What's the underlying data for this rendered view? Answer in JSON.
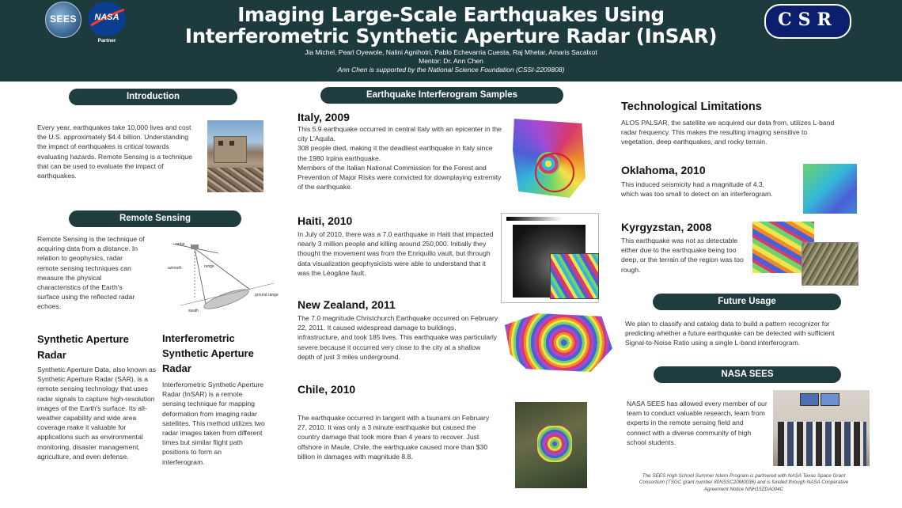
{
  "header": {
    "title_line1": "Imaging Large-Scale Earthquakes Using",
    "title_line2": "Interferometric Synthetic Aperture Radar (InSAR)",
    "authors": "Jia Michel, Pearl Oyewole, Nalini Agnihotri, Pablo Echevarria Cuesta, Raj Mhetar, Amaris Sacalxot",
    "mentor": "Mentor: Dr. Ann Chen",
    "support": "Ann Chen is supported by the National Science Foundation (CSSI-2209808)",
    "logo_sees": "SEES",
    "logo_nasa": "NASA",
    "logo_partner": "Partner",
    "logo_csr": "CSR"
  },
  "introduction": {
    "heading": "Introduction",
    "text": "Every year, earthquakes take 10,000 lives and cost the U.S. approximately $4.4 billion. Understanding the impact of earthquakes is critical towards evaluating hazards. Remote Sensing is a technique that can be used to evaluate the impact of earthquakes."
  },
  "remote_sensing": {
    "heading": "Remote Sensing",
    "text": "Remote Sensing is the technique of acquiring data from a distance. In relation to geophysics, radar remote sensing techniques can measure the physical characteristics of the Earth's surface using the reflected radar echoes.",
    "diagram_labels": {
      "radar": "radar",
      "azimuth": "azimuth",
      "range": "range",
      "ground_range": "ground range",
      "swath": "swath"
    }
  },
  "sar": {
    "heading": "Synthetic Aperture Radar",
    "text": "Synthetic Aperture Data, also known as Synthetic Aperture Radar (SAR), is a remote sensing technology that uses radar signals to capture high-resolution images of the Earth's surface. Its all-weather capability and wide area coverage make it valuable for applications such as environmental monitoring, disaster management, agriculture, and even defense."
  },
  "insar": {
    "heading": "Interferometric Synthetic Aperture Radar",
    "text": "Interferometric Synthetic Aperture Radar (InSAR) is a remote sensing technique for mapping deformation from imaging radar satellites. This method utilizes two radar images taken from different times but similar flight path positions to form an interferogram."
  },
  "samples": {
    "heading": "Earthquake Interferogram Samples",
    "italy": {
      "heading": "Italy, 2009",
      "text": "This 5.9 earthquake occurred in central Italy with an epicenter in the city L'Aquila.\n308 people died, making it the deadliest earthquake in Italy since the 1980 Irpina earthquake.\nMembers of the Italian National Commission for the Forest and Prevention of Major Risks were convicted for downplaying extremity of the earthquake."
    },
    "haiti": {
      "heading": "Haiti, 2010",
      "text": "In July of 2010, there was a 7.0 earthquake in Haiti that impacted nearly 3 million people and killing around 250,000. Initially they thought the movement was from the Enriquillo vault, but through data visualization geophysicists were able to understand that it was the Léogâne fault."
    },
    "nz": {
      "heading": "New Zealand, 2011",
      "text": "The 7.0 magnitude Christchurch Earthquake occurred on February 22, 2011. It caused widespread damage to buildings, infrastructure, and took 185 lives. This earthquake was particularly severe because it occurred very close to the city at a shallow depth of just 3 miles underground."
    },
    "chile": {
      "heading": "Chile, 2010",
      "text": "The earthquake occurred in tangent with a tsunami on February 27, 2010. It was only a 3 minute earthquake but caused the country damage that took more than 4 years to recover. Just offshore in Maule, Chile, the earthquake caused more than $30 billion in damages with magnitude 8.8."
    }
  },
  "limitations": {
    "heading": "Technological Limitations",
    "text": "ALOS PALSAR, the satellite we acquired our data from, utilizes L-band radar frequency. This makes the resulting imaging sensitive to vegetation, deep earthquakes, and rocky terrain.",
    "oklahoma": {
      "heading": "Oklahoma, 2010",
      "text": "This induced seismicity  had a magnitude of 4.3, which was too small to detect on an interferogram."
    },
    "kyrgyzstan": {
      "heading": "Kyrgyzstan, 2008",
      "text": "This earthquake was not as detectable either due to the earthquake being too deep, or the terrain of the region was too rough."
    }
  },
  "future": {
    "heading": "Future Usage",
    "text": "We plan to classify and catalog data to build a pattern recognizer for predicting whether a future earthquake can be detected with sufficient Signal-to-Noise Ratio using a single L-band interferogram."
  },
  "nasa_sees": {
    "heading": "NASA SEES",
    "text": "NASA SEES has allowed every member of our team to conduct valuable research, learn from experts in the remote sensing field and connect with a diverse community of high school students.",
    "footnote": "The SEES High School Summer Intern Program is partnered with NASA Texas Space Grant Consortium (TSGC grant number 80NSSC20M0036) and is funded through NASA Cooperative Agreement Notice NNH15ZDA004C"
  },
  "colors": {
    "header_bg": "#1d3a3d",
    "pill_bg": "#1f3c3f"
  }
}
